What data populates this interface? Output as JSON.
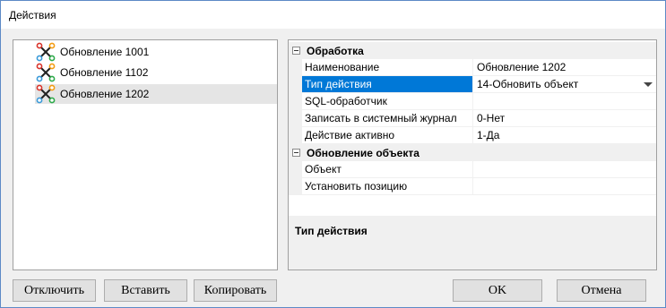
{
  "window": {
    "title": "Действия"
  },
  "tree": {
    "items": [
      {
        "label": "Обновление 1001",
        "icon": "workflow-icon",
        "selected": false
      },
      {
        "label": "Обновление 1102",
        "icon": "workflow-icon",
        "selected": false
      },
      {
        "label": "Обновление 1202",
        "icon": "workflow-icon",
        "selected": true
      }
    ]
  },
  "properties": {
    "categories": [
      {
        "label": "Обработка",
        "rows": [
          {
            "name": "Наименование",
            "value": "Обновление 1202"
          },
          {
            "name": "Тип действия",
            "value": "14-Обновить объект"
          },
          {
            "name": "SQL-обработчик",
            "value": ""
          },
          {
            "name": "Записать в системный журнал",
            "value": "0-Нет"
          },
          {
            "name": "Действие активно",
            "value": "1-Да"
          }
        ]
      },
      {
        "label": "Обновление объекта",
        "rows": [
          {
            "name": "Объект",
            "value": ""
          },
          {
            "name": "Установить позицию",
            "value": ""
          }
        ]
      }
    ],
    "selected_row": "Тип действия",
    "help_title": "Тип действия"
  },
  "buttons": {
    "disable": "Отключить",
    "insert": "Вставить",
    "copy": "Копировать",
    "ok": "OK",
    "cancel": "Отмена"
  },
  "colors": {
    "selection": "#0078d7",
    "window_border": "#5d8ac6"
  }
}
